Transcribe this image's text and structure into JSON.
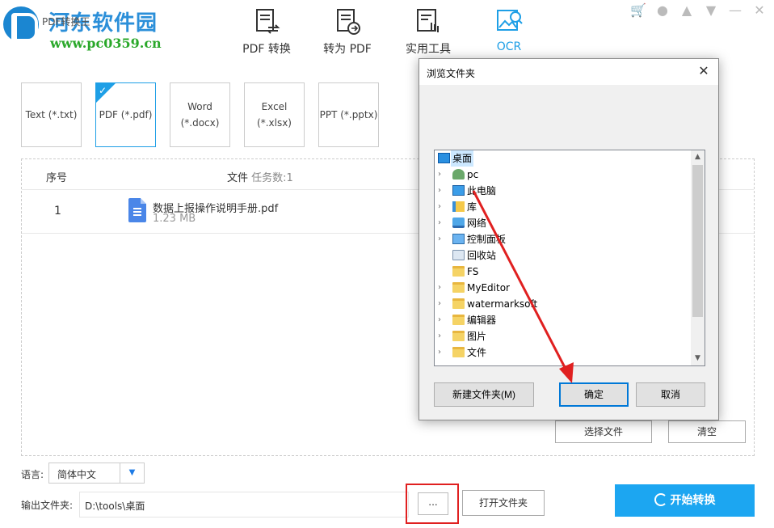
{
  "header": {
    "app_title": "PDF转换王",
    "watermark_title": "河东软件园",
    "watermark_url": "www.pc0359.cn",
    "nav": [
      {
        "label": "PDF 转换",
        "icon": "pdf-convert-icon",
        "active": false
      },
      {
        "label": "转为 PDF",
        "icon": "to-pdf-icon",
        "active": false
      },
      {
        "label": "实用工具",
        "icon": "tools-icon",
        "active": false
      },
      {
        "label": "OCR",
        "icon": "ocr-icon",
        "active": true
      }
    ],
    "top_icons": [
      "cart-icon",
      "user-icon",
      "bell-icon",
      "dropdown-icon",
      "minimize-icon",
      "close-icon"
    ]
  },
  "formats": [
    {
      "label": "Text (*.txt)",
      "selected": false
    },
    {
      "label": "PDF (*.pdf)",
      "selected": true
    },
    {
      "label_line1": "Word",
      "label_line2": "(*.docx)",
      "selected": false
    },
    {
      "label": "Excel (*.xlsx)",
      "selected": false
    },
    {
      "label": "PPT (*.pptx)",
      "selected": false
    }
  ],
  "file_list": {
    "col_no": "序号",
    "col_file": "文件",
    "task_count": "任务数:1",
    "rows": [
      {
        "no": "1",
        "name": "数据上报操作说明手册.pdf",
        "size": "1.23 MB"
      }
    ],
    "select_button": "选择文件",
    "clear_button": "清空"
  },
  "bottom": {
    "language_label": "语言:",
    "language_value": "简体中文",
    "output_label": "输出文件夹:",
    "output_path": "D:\\tools\\桌面",
    "browse_label": "...",
    "open_folder": "打开文件夹",
    "start_button": "开始转换"
  },
  "dialog": {
    "title": "浏览文件夹",
    "tree": [
      {
        "label": "桌面",
        "icon": "desktop-icon",
        "expandable": false,
        "selected": true,
        "indent": 0
      },
      {
        "label": "pc",
        "icon": "user-folder-icon",
        "expandable": true,
        "selected": false,
        "indent": 1
      },
      {
        "label": "此电脑",
        "icon": "computer-icon",
        "expandable": true,
        "selected": false,
        "indent": 1
      },
      {
        "label": "库",
        "icon": "library-icon",
        "expandable": true,
        "selected": false,
        "indent": 1
      },
      {
        "label": "网络",
        "icon": "network-icon",
        "expandable": true,
        "selected": false,
        "indent": 1
      },
      {
        "label": "控制面板",
        "icon": "control-panel-icon",
        "expandable": true,
        "selected": false,
        "indent": 1
      },
      {
        "label": "回收站",
        "icon": "recycle-bin-icon",
        "expandable": false,
        "selected": false,
        "indent": 1
      },
      {
        "label": "FS",
        "icon": "folder-icon",
        "expandable": false,
        "selected": false,
        "indent": 1
      },
      {
        "label": "MyEditor",
        "icon": "folder-icon",
        "expandable": true,
        "selected": false,
        "indent": 1
      },
      {
        "label": "watermarksoft",
        "icon": "folder-icon",
        "expandable": true,
        "selected": false,
        "indent": 1
      },
      {
        "label": "编辑器",
        "icon": "folder-icon",
        "expandable": true,
        "selected": false,
        "indent": 1
      },
      {
        "label": "图片",
        "icon": "folder-icon",
        "expandable": true,
        "selected": false,
        "indent": 1
      },
      {
        "label": "文件",
        "icon": "folder-icon",
        "expandable": true,
        "selected": false,
        "indent": 1
      }
    ],
    "new_folder": "新建文件夹(M)",
    "ok": "确定",
    "cancel": "取消"
  },
  "colors": {
    "accent": "#1e9fe6",
    "start_button": "#1ca6f1",
    "annotation_red": "#e02020"
  }
}
